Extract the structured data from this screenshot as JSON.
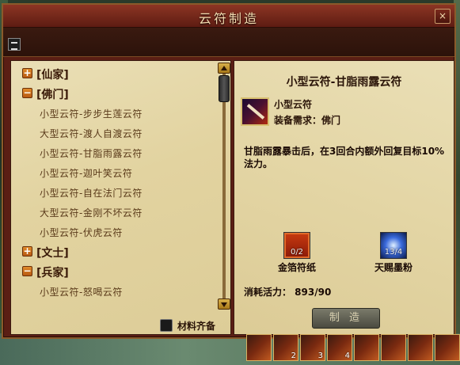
{
  "window": {
    "title": "云符制造",
    "close_label": "×"
  },
  "list": {
    "entries": [
      {
        "kind": "category",
        "sign": "+",
        "label": "[仙家]"
      },
      {
        "kind": "category",
        "sign": "−",
        "label": "[佛门]"
      },
      {
        "kind": "item",
        "label": "小型云符-步步生莲云符"
      },
      {
        "kind": "item",
        "label": "大型云符-渡人自渡云符"
      },
      {
        "kind": "item",
        "label": "小型云符-甘脂雨露云符"
      },
      {
        "kind": "item",
        "label": "小型云符-迦叶笑云符"
      },
      {
        "kind": "item",
        "label": "小型云符-自在法门云符"
      },
      {
        "kind": "item",
        "label": "大型云符-金刚不坏云符"
      },
      {
        "kind": "item",
        "label": "小型云符-伏虎云符"
      },
      {
        "kind": "category",
        "sign": "+",
        "label": "[文士]"
      },
      {
        "kind": "category",
        "sign": "−",
        "label": "[兵家]"
      },
      {
        "kind": "item",
        "label": "小型云符-怒喝云符"
      }
    ],
    "materials_check_label": "材料齐备"
  },
  "detail": {
    "title": "小型云符-甘脂雨露云符",
    "item_type": "小型云符",
    "requirement": "装备需求：佛门",
    "description": "甘脂雨露暴击后，在3回合内额外回复目标10%法力。",
    "materials": [
      {
        "name": "金箔符纸",
        "count": "0/2",
        "icon": "gold-foil-paper-icon"
      },
      {
        "name": "天赐墨粉",
        "count": "13/4",
        "icon": "ink-powder-icon"
      }
    ],
    "cost": "消耗活力： 893/90",
    "craft_label": "制 造"
  },
  "hotbar": {
    "slots": [
      "",
      "2",
      "3",
      "4",
      "",
      "",
      "",
      ""
    ]
  }
}
